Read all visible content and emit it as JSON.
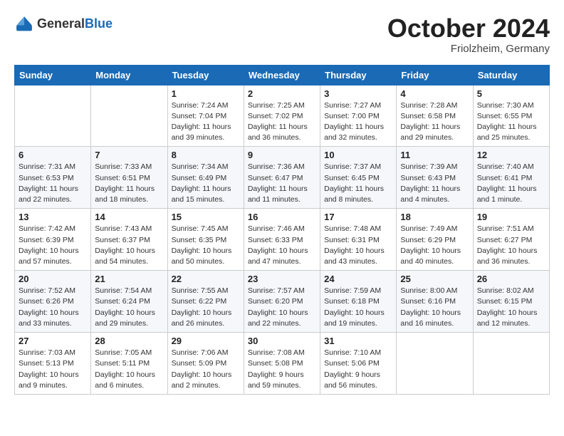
{
  "header": {
    "logo_general": "General",
    "logo_blue": "Blue",
    "month": "October 2024",
    "location": "Friolzheim, Germany"
  },
  "weekdays": [
    "Sunday",
    "Monday",
    "Tuesday",
    "Wednesday",
    "Thursday",
    "Friday",
    "Saturday"
  ],
  "weeks": [
    [
      {
        "day": "",
        "sunrise": "",
        "sunset": "",
        "daylight": ""
      },
      {
        "day": "",
        "sunrise": "",
        "sunset": "",
        "daylight": ""
      },
      {
        "day": "1",
        "sunrise": "Sunrise: 7:24 AM",
        "sunset": "Sunset: 7:04 PM",
        "daylight": "Daylight: 11 hours and 39 minutes."
      },
      {
        "day": "2",
        "sunrise": "Sunrise: 7:25 AM",
        "sunset": "Sunset: 7:02 PM",
        "daylight": "Daylight: 11 hours and 36 minutes."
      },
      {
        "day": "3",
        "sunrise": "Sunrise: 7:27 AM",
        "sunset": "Sunset: 7:00 PM",
        "daylight": "Daylight: 11 hours and 32 minutes."
      },
      {
        "day": "4",
        "sunrise": "Sunrise: 7:28 AM",
        "sunset": "Sunset: 6:58 PM",
        "daylight": "Daylight: 11 hours and 29 minutes."
      },
      {
        "day": "5",
        "sunrise": "Sunrise: 7:30 AM",
        "sunset": "Sunset: 6:55 PM",
        "daylight": "Daylight: 11 hours and 25 minutes."
      }
    ],
    [
      {
        "day": "6",
        "sunrise": "Sunrise: 7:31 AM",
        "sunset": "Sunset: 6:53 PM",
        "daylight": "Daylight: 11 hours and 22 minutes."
      },
      {
        "day": "7",
        "sunrise": "Sunrise: 7:33 AM",
        "sunset": "Sunset: 6:51 PM",
        "daylight": "Daylight: 11 hours and 18 minutes."
      },
      {
        "day": "8",
        "sunrise": "Sunrise: 7:34 AM",
        "sunset": "Sunset: 6:49 PM",
        "daylight": "Daylight: 11 hours and 15 minutes."
      },
      {
        "day": "9",
        "sunrise": "Sunrise: 7:36 AM",
        "sunset": "Sunset: 6:47 PM",
        "daylight": "Daylight: 11 hours and 11 minutes."
      },
      {
        "day": "10",
        "sunrise": "Sunrise: 7:37 AM",
        "sunset": "Sunset: 6:45 PM",
        "daylight": "Daylight: 11 hours and 8 minutes."
      },
      {
        "day": "11",
        "sunrise": "Sunrise: 7:39 AM",
        "sunset": "Sunset: 6:43 PM",
        "daylight": "Daylight: 11 hours and 4 minutes."
      },
      {
        "day": "12",
        "sunrise": "Sunrise: 7:40 AM",
        "sunset": "Sunset: 6:41 PM",
        "daylight": "Daylight: 11 hours and 1 minute."
      }
    ],
    [
      {
        "day": "13",
        "sunrise": "Sunrise: 7:42 AM",
        "sunset": "Sunset: 6:39 PM",
        "daylight": "Daylight: 10 hours and 57 minutes."
      },
      {
        "day": "14",
        "sunrise": "Sunrise: 7:43 AM",
        "sunset": "Sunset: 6:37 PM",
        "daylight": "Daylight: 10 hours and 54 minutes."
      },
      {
        "day": "15",
        "sunrise": "Sunrise: 7:45 AM",
        "sunset": "Sunset: 6:35 PM",
        "daylight": "Daylight: 10 hours and 50 minutes."
      },
      {
        "day": "16",
        "sunrise": "Sunrise: 7:46 AM",
        "sunset": "Sunset: 6:33 PM",
        "daylight": "Daylight: 10 hours and 47 minutes."
      },
      {
        "day": "17",
        "sunrise": "Sunrise: 7:48 AM",
        "sunset": "Sunset: 6:31 PM",
        "daylight": "Daylight: 10 hours and 43 minutes."
      },
      {
        "day": "18",
        "sunrise": "Sunrise: 7:49 AM",
        "sunset": "Sunset: 6:29 PM",
        "daylight": "Daylight: 10 hours and 40 minutes."
      },
      {
        "day": "19",
        "sunrise": "Sunrise: 7:51 AM",
        "sunset": "Sunset: 6:27 PM",
        "daylight": "Daylight: 10 hours and 36 minutes."
      }
    ],
    [
      {
        "day": "20",
        "sunrise": "Sunrise: 7:52 AM",
        "sunset": "Sunset: 6:26 PM",
        "daylight": "Daylight: 10 hours and 33 minutes."
      },
      {
        "day": "21",
        "sunrise": "Sunrise: 7:54 AM",
        "sunset": "Sunset: 6:24 PM",
        "daylight": "Daylight: 10 hours and 29 minutes."
      },
      {
        "day": "22",
        "sunrise": "Sunrise: 7:55 AM",
        "sunset": "Sunset: 6:22 PM",
        "daylight": "Daylight: 10 hours and 26 minutes."
      },
      {
        "day": "23",
        "sunrise": "Sunrise: 7:57 AM",
        "sunset": "Sunset: 6:20 PM",
        "daylight": "Daylight: 10 hours and 22 minutes."
      },
      {
        "day": "24",
        "sunrise": "Sunrise: 7:59 AM",
        "sunset": "Sunset: 6:18 PM",
        "daylight": "Daylight: 10 hours and 19 minutes."
      },
      {
        "day": "25",
        "sunrise": "Sunrise: 8:00 AM",
        "sunset": "Sunset: 6:16 PM",
        "daylight": "Daylight: 10 hours and 16 minutes."
      },
      {
        "day": "26",
        "sunrise": "Sunrise: 8:02 AM",
        "sunset": "Sunset: 6:15 PM",
        "daylight": "Daylight: 10 hours and 12 minutes."
      }
    ],
    [
      {
        "day": "27",
        "sunrise": "Sunrise: 7:03 AM",
        "sunset": "Sunset: 5:13 PM",
        "daylight": "Daylight: 10 hours and 9 minutes."
      },
      {
        "day": "28",
        "sunrise": "Sunrise: 7:05 AM",
        "sunset": "Sunset: 5:11 PM",
        "daylight": "Daylight: 10 hours and 6 minutes."
      },
      {
        "day": "29",
        "sunrise": "Sunrise: 7:06 AM",
        "sunset": "Sunset: 5:09 PM",
        "daylight": "Daylight: 10 hours and 2 minutes."
      },
      {
        "day": "30",
        "sunrise": "Sunrise: 7:08 AM",
        "sunset": "Sunset: 5:08 PM",
        "daylight": "Daylight: 9 hours and 59 minutes."
      },
      {
        "day": "31",
        "sunrise": "Sunrise: 7:10 AM",
        "sunset": "Sunset: 5:06 PM",
        "daylight": "Daylight: 9 hours and 56 minutes."
      },
      {
        "day": "",
        "sunrise": "",
        "sunset": "",
        "daylight": ""
      },
      {
        "day": "",
        "sunrise": "",
        "sunset": "",
        "daylight": ""
      }
    ]
  ]
}
